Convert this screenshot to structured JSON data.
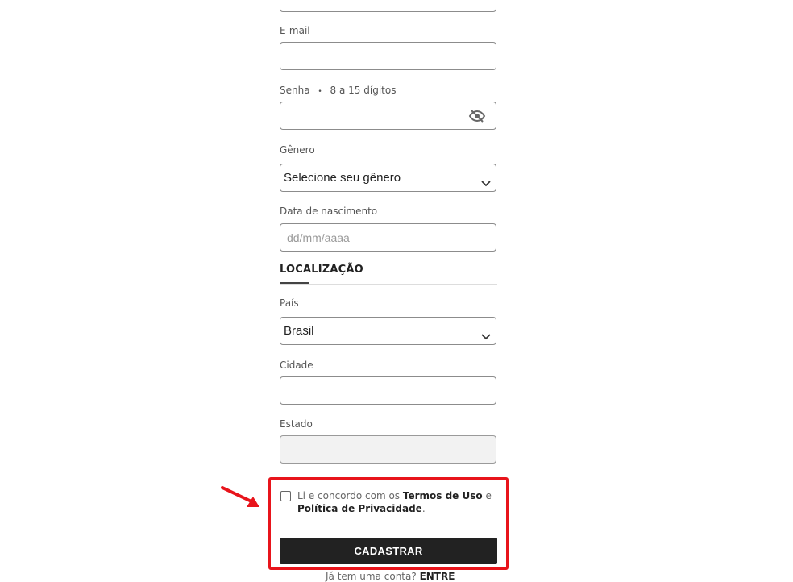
{
  "form": {
    "email_label": "E-mail",
    "password_label": "Senha",
    "password_separator": "•",
    "password_hint": "8 a 15 dígitos",
    "gender_label": "Gênero",
    "gender_selected": "Selecione seu gênero",
    "birthdate_label": "Data de nascimento",
    "birthdate_placeholder": "dd/mm/aaaa"
  },
  "location": {
    "section_title": "LOCALIZAÇÃO",
    "country_label": "País",
    "country_selected": "Brasil",
    "city_label": "Cidade",
    "state_label": "Estado"
  },
  "terms": {
    "prefix": "Li e concordo com os ",
    "terms_link": "Termos de Uso",
    "conjunction": " e ",
    "privacy_link": "Política de Privacidade",
    "suffix": "."
  },
  "submit_label": "CADASTRAR",
  "login": {
    "prompt": "Já tem uma conta? ",
    "link": "ENTRE"
  },
  "colors": {
    "highlight": "#e8141b",
    "button_bg": "#222222",
    "disabled_field_bg": "#f2f2f2"
  },
  "icons": {
    "password_toggle": "eye-slash-icon",
    "dropdown": "chevron-down-icon",
    "annotation": "arrow-icon"
  }
}
